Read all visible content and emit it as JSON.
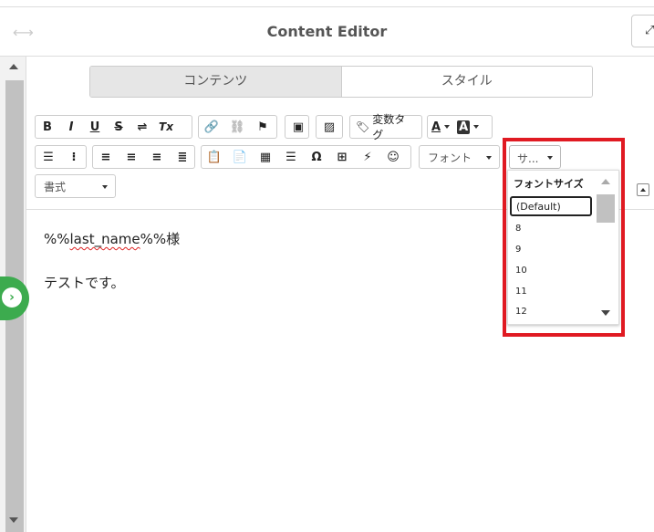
{
  "header": {
    "title": "Content Editor",
    "expand_icon": "expand-arrows-icon"
  },
  "tabs": [
    {
      "label": "コンテンツ",
      "active": true
    },
    {
      "label": "スタイル",
      "active": false
    }
  ],
  "toolbar": {
    "row1": {
      "format": [
        "B",
        "I",
        "U",
        "S",
        "⇌",
        "Tx"
      ],
      "variable_tag": "変数タグ",
      "text_color": "A",
      "bg_color": "A"
    },
    "row2": {
      "font_label": "フォント",
      "size_label": "サ..."
    },
    "row3": {
      "format_label": "書式"
    }
  },
  "size_menu": {
    "header": "フォントサイズ",
    "items": [
      "(Default)",
      "8",
      "9",
      "10",
      "11",
      "12"
    ],
    "selected": "(Default)"
  },
  "editor": {
    "line1_prefix": "%%",
    "line1_var": "last_name",
    "line1_suffix": "%%様",
    "line2": "テストです。"
  },
  "colors": {
    "accent_green": "#3cab4e",
    "highlight_red": "#e01a22"
  }
}
